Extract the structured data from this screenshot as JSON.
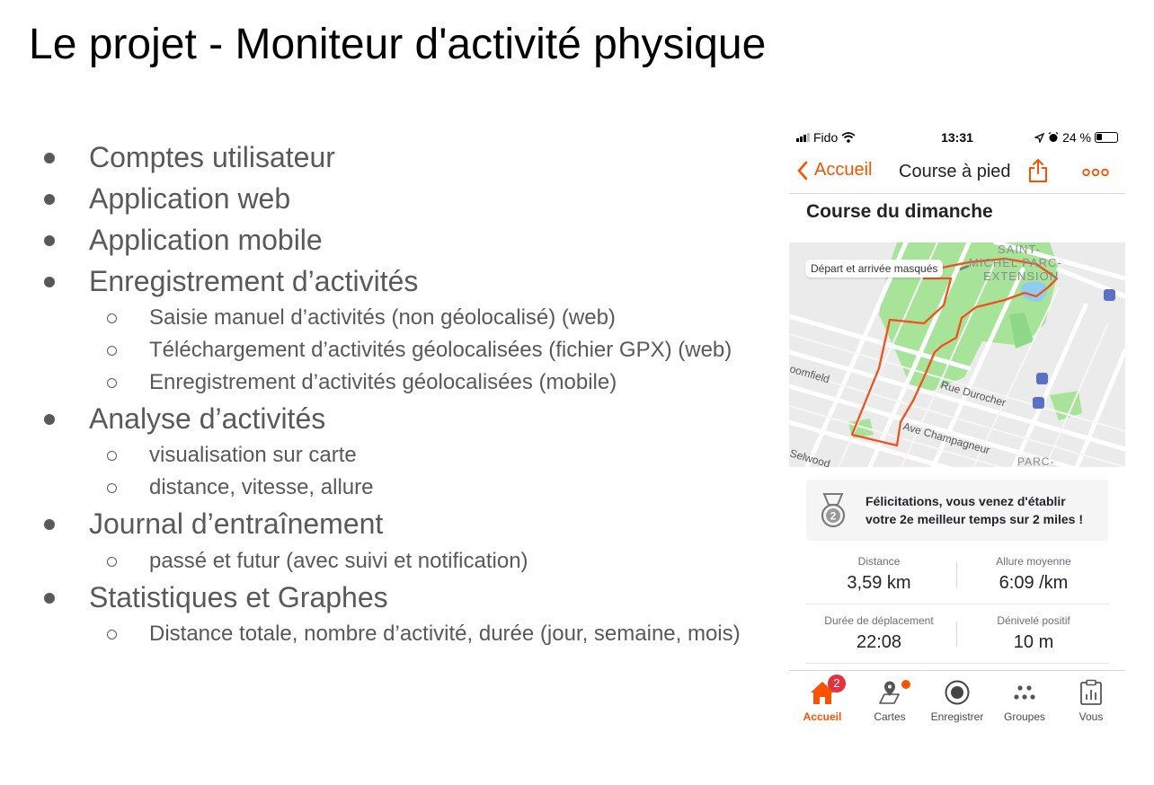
{
  "slide": {
    "title": "Le projet - Moniteur d'activité physique",
    "items": [
      {
        "text": "Comptes utilisateur"
      },
      {
        "text": "Application web"
      },
      {
        "text": "Application mobile"
      },
      {
        "text": "Enregistrement d’activités"
      },
      {
        "text": "Saisie manuel d’activités (non géolocalisé) (web)"
      },
      {
        "text": "Téléchargement d’activités géolocalisées (fichier GPX) (web)"
      },
      {
        "text": "Enregistrement d’activités géolocalisées (mobile)"
      },
      {
        "text": "Analyse d’activités"
      },
      {
        "text": "visualisation sur carte"
      },
      {
        "text": "distance, vitesse, allure"
      },
      {
        "text": "Journal d’entraînement"
      },
      {
        "text": "passé et futur (avec suivi et notification)"
      },
      {
        "text": "Statistiques et Graphes"
      },
      {
        "text": "Distance totale, nombre d’activité, durée (jour, semaine, mois)"
      }
    ]
  },
  "phone": {
    "status": {
      "carrier": "Fido",
      "time": "13:31",
      "battery": "24 %"
    },
    "nav": {
      "back_label": "Accueil",
      "title": "Course à pied"
    },
    "activity_title": "Course du dimanche",
    "map": {
      "privacy_label": "Départ et arrivée masqués",
      "labels": {
        "area1": "SAINT-",
        "area2": "MICHEL PARC-",
        "area3": "EXTENSION",
        "street1": "Rue Durocher",
        "street2": "Ave Champagneur",
        "street3": "oomfield",
        "street4": "Selwood",
        "area4": "PARC-"
      }
    },
    "achievement": {
      "line1": "Félicitations, vous venez d'établir",
      "line2": "votre 2e meilleur temps sur 2 miles !"
    },
    "stats": {
      "distance_label": "Distance",
      "distance_value": "3,59 km",
      "pace_label": "Allure moyenne",
      "pace_value": "6:09 /km",
      "moving_label": "Durée de déplacement",
      "moving_value": "22:08",
      "elev_label": "Dénivelé positif",
      "elev_value": "10 m"
    },
    "tabs": {
      "home": "Accueil",
      "home_badge": "2",
      "maps": "Cartes",
      "record": "Enregistrer",
      "groups": "Groupes",
      "you": "Vous"
    },
    "colors": {
      "accent": "#fc5200",
      "badge": "#e6313f",
      "park": "#a8e39a",
      "map_bg": "#ebebec",
      "route": "#f2501c"
    },
    "icons": {
      "back": "chevron-left-icon",
      "share": "share-icon",
      "more": "more-icon",
      "medal": "medal-icon",
      "home": "home-icon",
      "maps": "map-pin-icon",
      "record": "record-icon",
      "groups": "groups-icon",
      "you": "clipboard-icon"
    }
  }
}
